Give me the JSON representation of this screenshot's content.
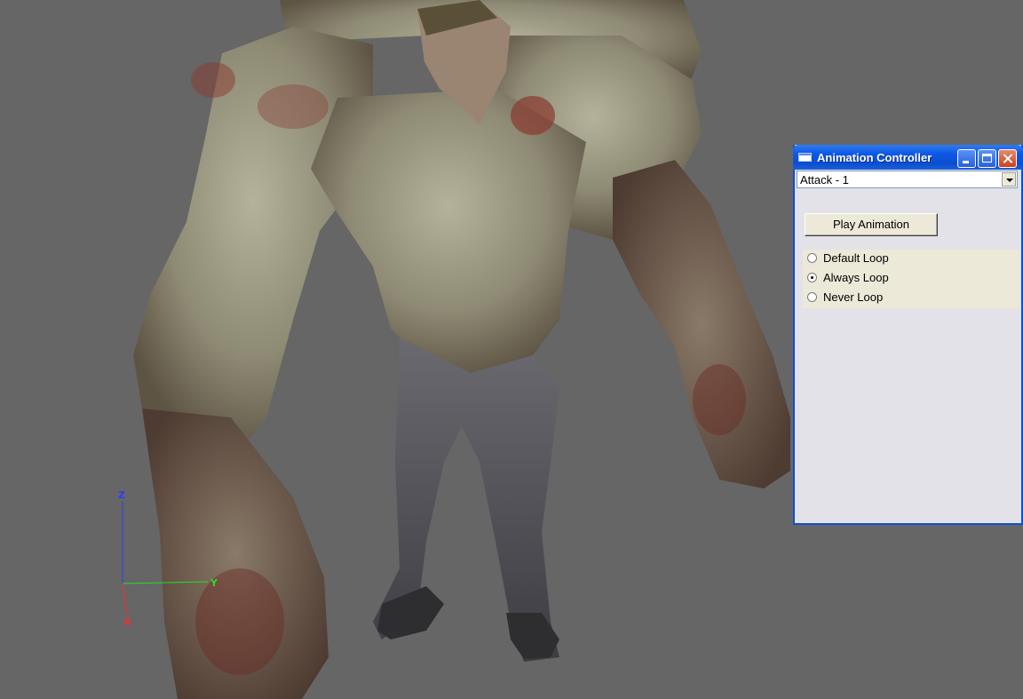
{
  "window": {
    "title": "Animation Controller",
    "minimize_icon": "minimize-icon",
    "maximize_icon": "maximize-icon",
    "close_icon": "close-icon"
  },
  "animation_select": {
    "value": "Attack - 1"
  },
  "play_button": {
    "label": "Play Animation"
  },
  "loop_options": [
    {
      "label": "Default Loop",
      "checked": false
    },
    {
      "label": "Always Loop",
      "checked": true
    },
    {
      "label": "Never Loop",
      "checked": false
    }
  ],
  "axis_gizmo": {
    "z_label": "Z",
    "y_label": "Y",
    "x_label": "X",
    "z_color": "#2a3cff",
    "y_color": "#22e022",
    "x_color": "#ff2a2a"
  },
  "colors": {
    "viewport_background": "#666666",
    "title_bar": "#0a4fd0",
    "window_body": "#e3e2e8"
  }
}
